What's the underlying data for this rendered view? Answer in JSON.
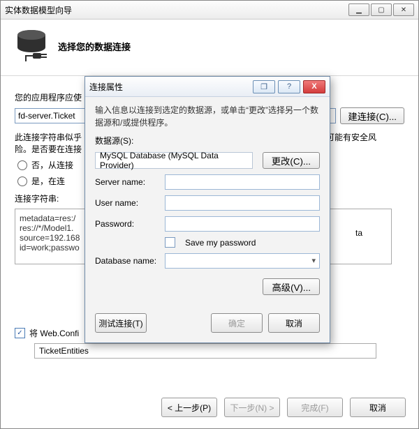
{
  "window": {
    "title": "实体数据模型向导",
    "minimize_glyph": "▁",
    "maximize_glyph": "▢",
    "close_glyph": "✕"
  },
  "header": {
    "title": "选择您的数据连接"
  },
  "main": {
    "prompt": "您的应用程序应使",
    "connection_value": "fd-server.Ticket",
    "new_conn_btn": "建连接(C)...",
    "warning_line1": "此连接字符串似乎",
    "warning_line2": "险。是否要在连接",
    "warning_tail": "居可能有安全风",
    "radio_no": "否，从连接",
    "radio_yes": "是，在连",
    "conn_string_label": "连接字符串:",
    "conn_string_value": "metadata=res:/\nres://*/Model1.\nsource=192.168\nid=work;passwo",
    "conn_string_tail": "ta",
    "save_label": "将 Web.Confi",
    "named_value": "TicketEntities"
  },
  "buttons": {
    "prev": "< 上一步(P)",
    "next": "下一步(N) >",
    "finish": "完成(F)",
    "cancel": "取消"
  },
  "modal": {
    "title": "连接属性",
    "info": "输入信息以连接到选定的数据源，或单击“更改”选择另一个数据源和/或提供程序。",
    "datasource_label": "数据源(S):",
    "datasource_value": "MySQL Database (MySQL Data Provider)",
    "change_btn": "更改(C)...",
    "server_label": "Server name:",
    "user_label": "User name:",
    "password_label": "Password:",
    "save_pwd": "Save my password",
    "database_label": "Database name:",
    "advanced_btn": "高级(V)...",
    "test_btn": "测试连接(T)",
    "ok_btn": "确定",
    "cancel_btn": "取消",
    "restore_glyph": "❐",
    "help_glyph": "?",
    "close_glyph": "X"
  }
}
